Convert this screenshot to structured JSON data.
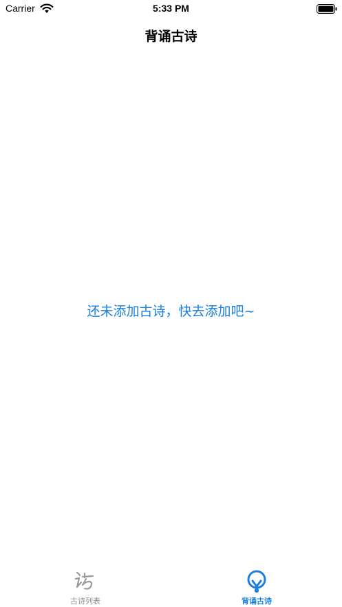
{
  "status_bar": {
    "carrier": "Carrier",
    "time": "5:33 PM"
  },
  "nav": {
    "title": "背诵古诗"
  },
  "empty_state": {
    "message": "还未添加古诗，快去添加吧~"
  },
  "tab_bar": {
    "tabs": [
      {
        "label": "古诗列表",
        "icon": "poem-calligraphy-icon",
        "selected": false
      },
      {
        "label": "背诵古诗",
        "icon": "lightbulb-icon",
        "selected": true
      }
    ]
  },
  "colors": {
    "accent": "#1a7fe0",
    "inactive": "#8e8e93",
    "background": "#ffffff"
  }
}
